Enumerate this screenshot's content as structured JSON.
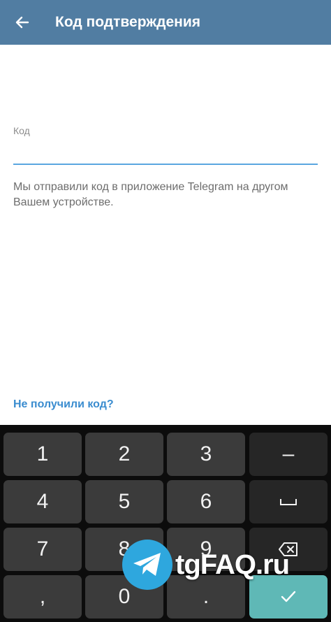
{
  "appbar": {
    "title": "Код подтверждения",
    "back_icon": "arrow-left-icon",
    "background": "#517da2"
  },
  "form": {
    "code_label": "Код",
    "code_value": "",
    "info_text": "Мы отправили код в приложение Telegram на другом Вашем устройстве.",
    "resend_link": "Не получили код?",
    "accent": "#5aa6e0",
    "link_color": "#3a8ccf"
  },
  "keyboard": {
    "keys": {
      "k1": "1",
      "k2": "2",
      "k3": "3",
      "minus": "–",
      "k4": "4",
      "k5": "5",
      "k6": "6",
      "k7": "7",
      "k8": "8",
      "k9": "9",
      "comma": ",",
      "k0": "0",
      "dot": "."
    },
    "space_icon": "space-icon",
    "backspace_icon": "backspace-icon",
    "confirm_icon": "check-icon",
    "confirm_color": "#5fb8b6"
  },
  "watermark": {
    "text": "tgFAQ.ru",
    "icon": "telegram-plane-icon",
    "color": "#2ea7de"
  }
}
